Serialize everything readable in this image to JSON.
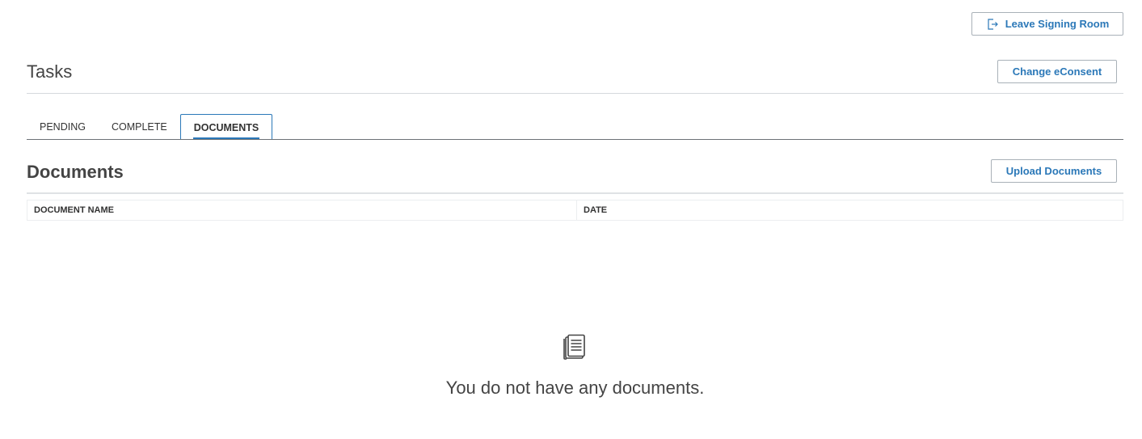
{
  "header": {
    "leave_label": "Leave Signing Room",
    "econsent_label": "Change eConsent"
  },
  "tasks": {
    "title": "Tasks",
    "tabs": [
      {
        "label": "PENDING",
        "active": false
      },
      {
        "label": "COMPLETE",
        "active": false
      },
      {
        "label": "DOCUMENTS",
        "active": true
      }
    ]
  },
  "documents": {
    "title": "Documents",
    "upload_label": "Upload Documents",
    "columns": [
      "DOCUMENT NAME",
      "DATE"
    ],
    "rows": [],
    "empty_message": "You do not have any documents."
  },
  "icons": {
    "leave": "exit-door-icon",
    "empty": "document-icon"
  },
  "colors": {
    "accent": "#2b78b8",
    "text": "#333333",
    "border": "#a9b1b8"
  }
}
